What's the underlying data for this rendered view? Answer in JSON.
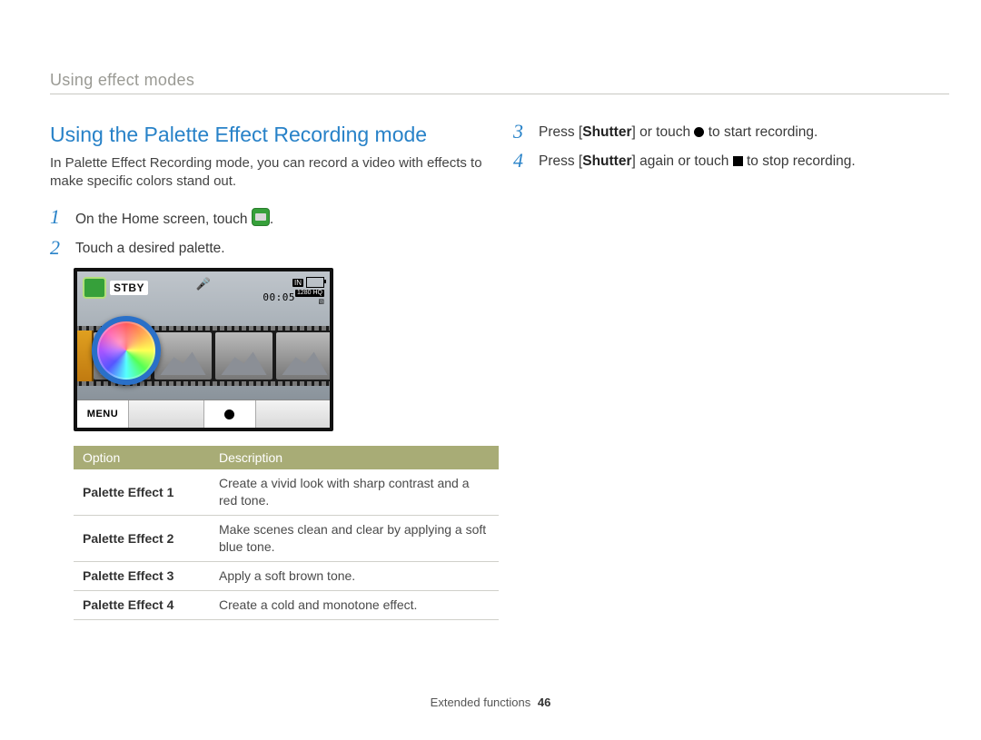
{
  "breadcrumb": "Using effect modes",
  "section_title": "Using the Palette Effect Recording mode",
  "intro": "In Palette Effect Recording mode, you can record a video with effects to make specific colors stand out.",
  "steps_left": [
    {
      "num": "1",
      "prefix": "On the Home screen, touch ",
      "icon": "home",
      "suffix": "."
    },
    {
      "num": "2",
      "prefix": "Touch a desired palette.",
      "icon": null,
      "suffix": ""
    }
  ],
  "steps_right": [
    {
      "num": "3",
      "pre": "Press [",
      "bold": "Shutter",
      "mid": "] or touch ",
      "icon": "dot",
      "post": " to start recording."
    },
    {
      "num": "4",
      "pre": "Press [",
      "bold": "Shutter",
      "mid": "] again or touch ",
      "icon": "stop",
      "post": " to stop recording."
    }
  ],
  "screen": {
    "stby": "STBY",
    "timer": "00:05",
    "in": "IN",
    "res": "1280 HQ",
    "menu": "MENU"
  },
  "table": {
    "headers": [
      "Option",
      "Description"
    ],
    "rows": [
      {
        "option": "Palette Effect 1",
        "desc": "Create a vivid look with sharp contrast and a red tone."
      },
      {
        "option": "Palette Effect 2",
        "desc": "Make scenes clean and clear by applying a soft blue tone."
      },
      {
        "option": "Palette Effect 3",
        "desc": "Apply a soft brown tone."
      },
      {
        "option": "Palette Effect 4",
        "desc": "Create a cold and monotone effect."
      }
    ]
  },
  "footer": {
    "section": "Extended functions",
    "page": "46"
  }
}
